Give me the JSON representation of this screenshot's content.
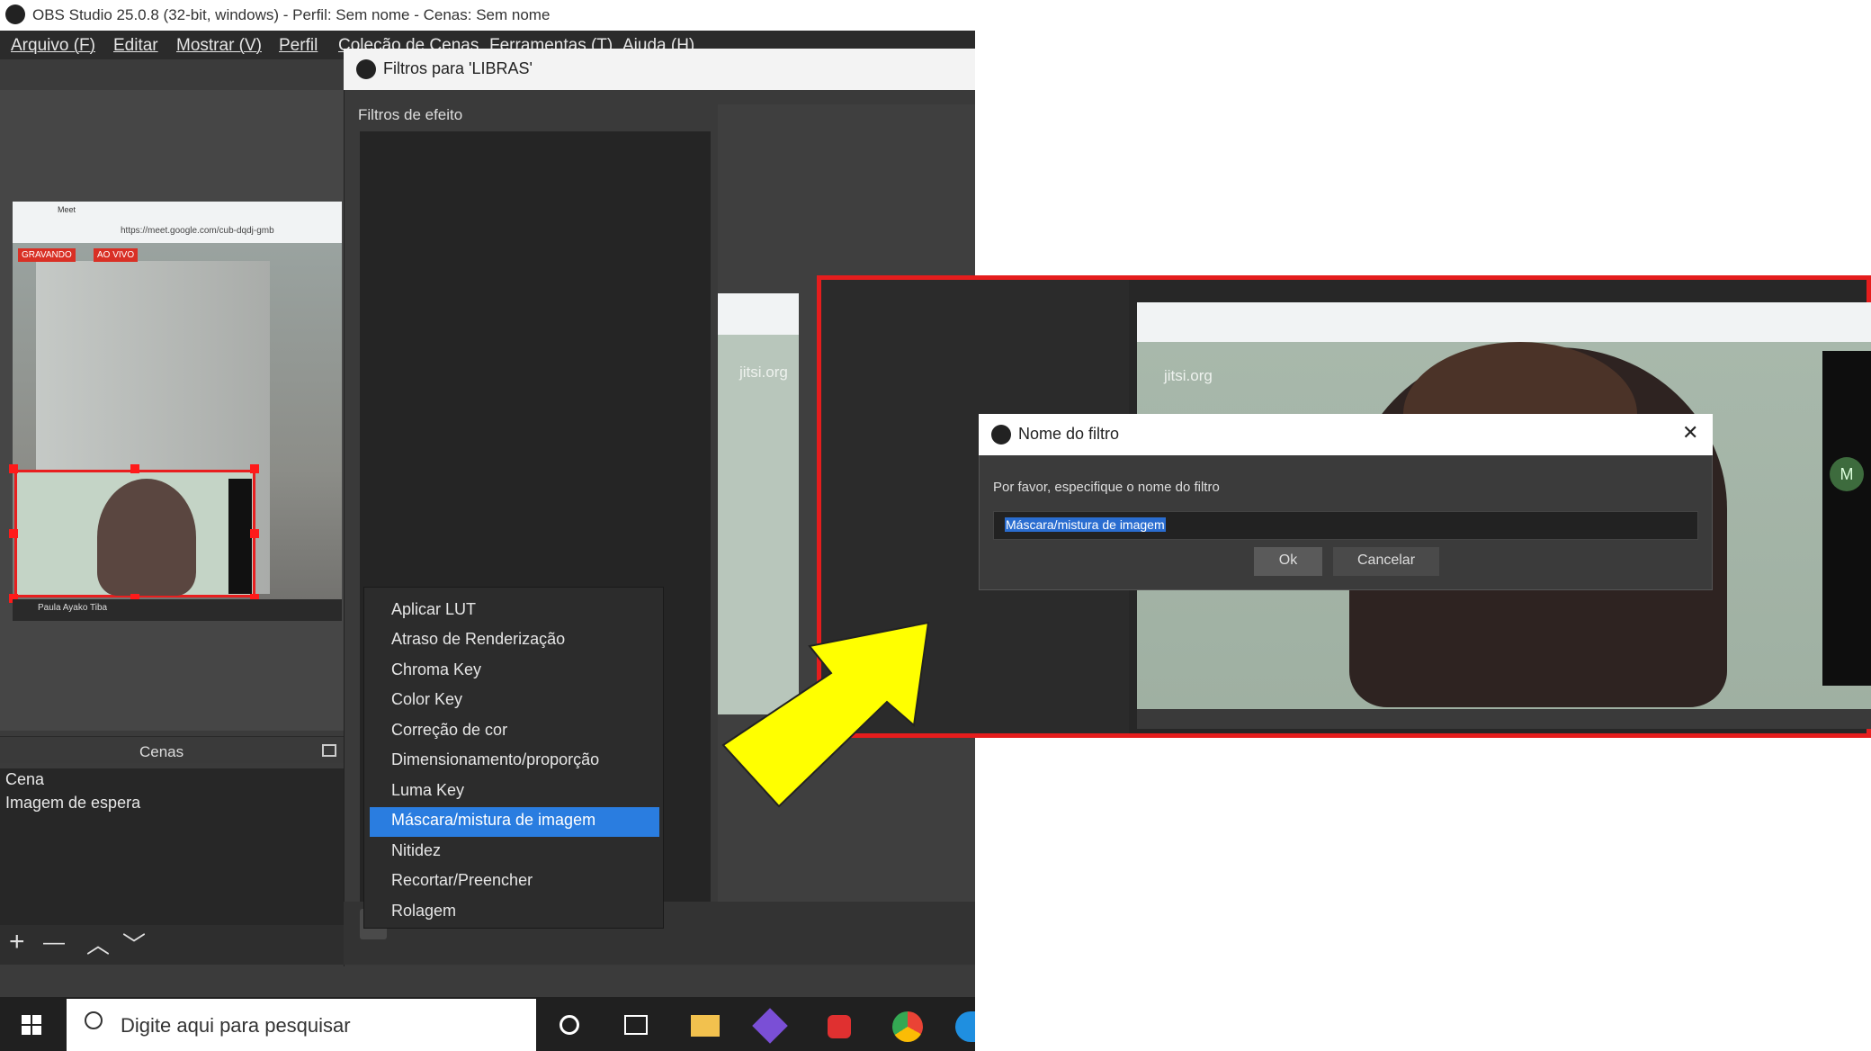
{
  "window": {
    "title": "OBS Studio 25.0.8 (32-bit, windows) - Perfil: Sem nome - Cenas: Sem nome"
  },
  "menu": {
    "items": [
      "Arquivo (F)",
      "Editar",
      "Mostrar (V)",
      "Perfil",
      "Coleção de Cenas",
      "Ferramentas (T)",
      "Ajuda (H)"
    ]
  },
  "preview": {
    "browser_tab": "Meet",
    "url": "https://meet.google.com/cub-dqdj-gmb",
    "badge_recording": "GRAVANDO",
    "badge_live": "AO VIVO",
    "caption": "Paula Ayako Tiba"
  },
  "scenes": {
    "header": "Cenas",
    "items": [
      "Cena",
      "Imagem de espera"
    ],
    "toolbar": {
      "add": "+",
      "remove": "—",
      "up": "︿",
      "down": "﹀"
    }
  },
  "filters_dialog": {
    "title": "Filtros para 'LIBRAS'",
    "section_label": "Filtros de efeito",
    "watermark": "jitsi.org"
  },
  "context_menu": {
    "items": [
      "Aplicar LUT",
      "Atraso de Renderização",
      "Chroma Key",
      "Color Key",
      "Correção de cor",
      "Dimensionamento/proporção",
      "Luma Key",
      "Máscara/mistura de imagem",
      "Nitidez",
      "Recortar/Preencher",
      "Rolagem"
    ],
    "selected": "Máscara/mistura de imagem"
  },
  "name_dialog": {
    "title": "Nome do filtro",
    "prompt": "Por favor, especifique o nome do filtro",
    "value": "Máscara/mistura de imagem",
    "ok": "Ok",
    "cancel": "Cancelar",
    "close": "✕"
  },
  "inset": {
    "watermark": "jitsi.org",
    "avatar_letter": "M"
  },
  "taskbar": {
    "search_placeholder": "Digite aqui para pesquisar"
  },
  "colors": {
    "highlight": "#2a7de0",
    "annotation_red": "#e51d1d",
    "arrow_yellow": "#ffff00"
  }
}
